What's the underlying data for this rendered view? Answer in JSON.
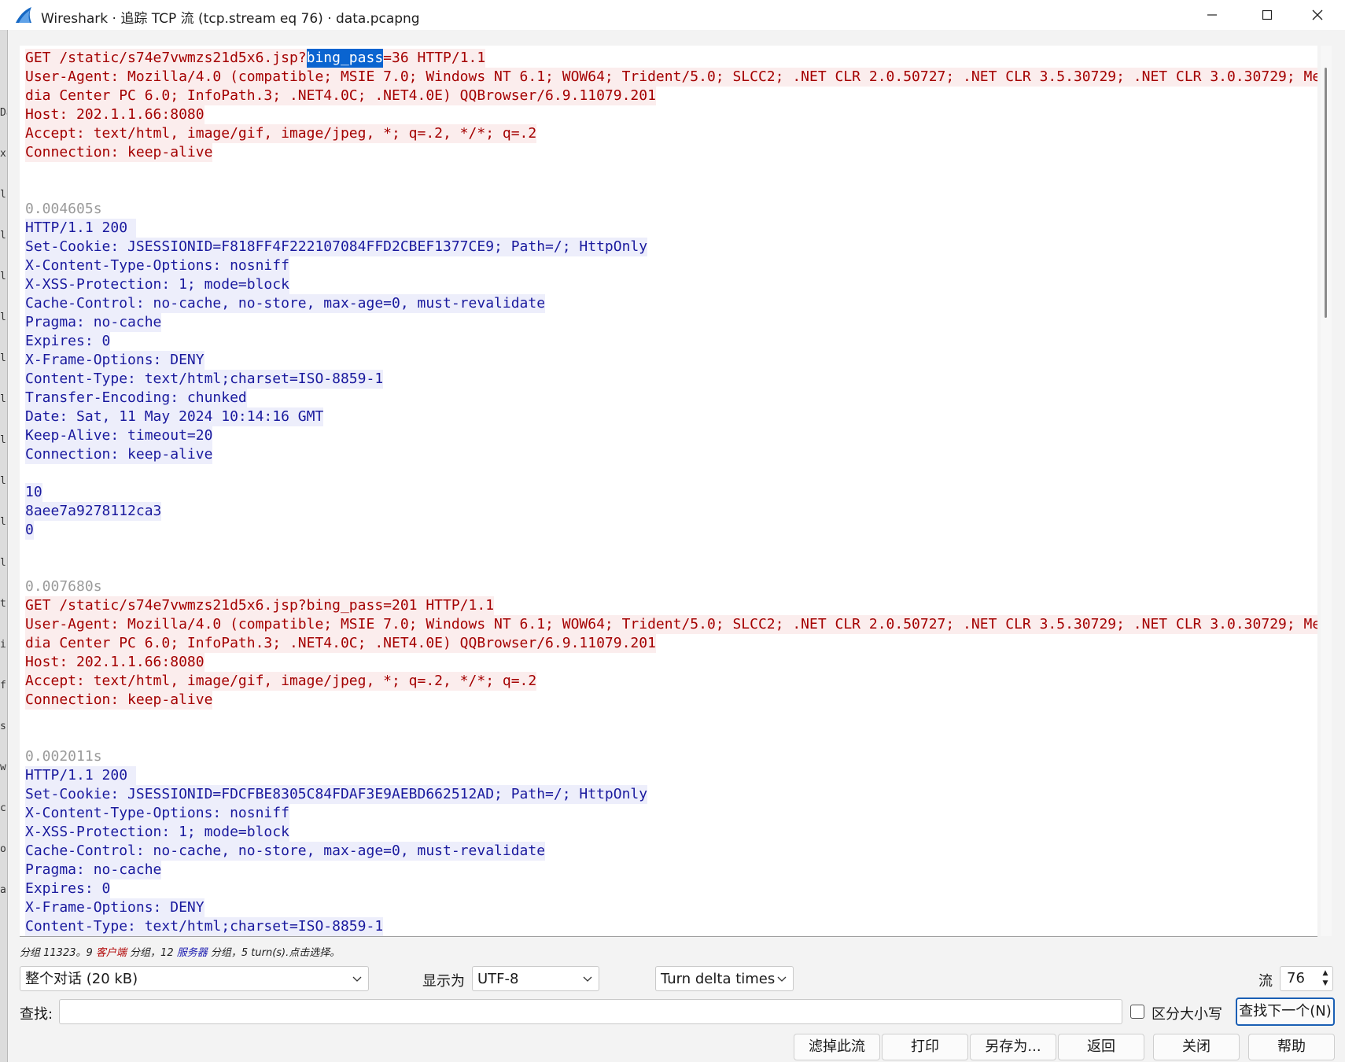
{
  "window": {
    "title": "Wireshark · 追踪 TCP 流 (tcp.stream eq 76) · data.pcapng"
  },
  "stream": {
    "blocks": [
      {
        "kind": "client",
        "time": "",
        "lines": [
          [
            "GET /static/s74e7vwmzs21d5x6.jsp?",
            "bing_pass",
            "=36 HTTP/1.1"
          ],
          "User-Agent: Mozilla/4.0 (compatible; MSIE 7.0; Windows NT 6.1; WOW64; Trident/5.0; SLCC2; .NET CLR 2.0.50727; .NET CLR 3.5.30729; .NET CLR 3.0.30729; Me",
          "dia Center PC 6.0; InfoPath.3; .NET4.0C; .NET4.0E) QQBrowser/6.9.11079.201",
          "Host: 202.1.1.66:8080",
          "Accept: text/html, image/gif, image/jpeg, *; q=.2, */*; q=.2",
          "Connection: keep-alive",
          ""
        ]
      },
      {
        "kind": "server",
        "time": "0.004605s",
        "lines": [
          "HTTP/1.1 200 ",
          "Set-Cookie: JSESSIONID=F818FF4F222107084FFD2CBEF1377CE9; Path=/; HttpOnly",
          "X-Content-Type-Options: nosniff",
          "X-XSS-Protection: 1; mode=block",
          "Cache-Control: no-cache, no-store, max-age=0, must-revalidate",
          "Pragma: no-cache",
          "Expires: 0",
          "X-Frame-Options: DENY",
          "Content-Type: text/html;charset=ISO-8859-1",
          "Transfer-Encoding: chunked",
          "Date: Sat, 11 May 2024 10:14:16 GMT",
          "Keep-Alive: timeout=20",
          "Connection: keep-alive",
          "",
          "10",
          "8aee7a9278112ca3",
          "0",
          ""
        ]
      },
      {
        "kind": "client",
        "time": "0.007680s",
        "lines": [
          "GET /static/s74e7vwmzs21d5x6.jsp?bing_pass=201 HTTP/1.1",
          "User-Agent: Mozilla/4.0 (compatible; MSIE 7.0; Windows NT 6.1; WOW64; Trident/5.0; SLCC2; .NET CLR 2.0.50727; .NET CLR 3.5.30729; .NET CLR 3.0.30729; Me",
          "dia Center PC 6.0; InfoPath.3; .NET4.0C; .NET4.0E) QQBrowser/6.9.11079.201",
          "Host: 202.1.1.66:8080",
          "Accept: text/html, image/gif, image/jpeg, *; q=.2, */*; q=.2",
          "Connection: keep-alive",
          ""
        ]
      },
      {
        "kind": "server",
        "time": "0.002011s",
        "lines": [
          "HTTP/1.1 200 ",
          "Set-Cookie: JSESSIONID=FDCFBE8305C84FDAF3E9AEBD662512AD; Path=/; HttpOnly",
          "X-Content-Type-Options: nosniff",
          "X-XSS-Protection: 1; mode=block",
          "Cache-Control: no-cache, no-store, max-age=0, must-revalidate",
          "Pragma: no-cache",
          "Expires: 0",
          "X-Frame-Options: DENY",
          "Content-Type: text/html;charset=ISO-8859-1"
        ]
      }
    ]
  },
  "status": {
    "prefix": "分组 11323。9 ",
    "client_label": "客户端",
    "middle": " 分组，12 ",
    "server_label": "服务器",
    "suffix": " 分组，5 turn(s).点击选择。"
  },
  "controls": {
    "conversation": "整个对话  (20 kB)",
    "show_as_label": "显示为",
    "encoding": "UTF-8",
    "delta_mode": "Turn delta times",
    "stream_label": "流",
    "stream_number": "76"
  },
  "find": {
    "label": "查找:",
    "value": "",
    "case_label": "区分大小写",
    "next_label": "查找下一个(N)"
  },
  "buttons": {
    "filter_out": "滤掉此流",
    "print": "打印",
    "save_as": "另存为...",
    "back": "返回",
    "close": "关闭",
    "help": "帮助"
  },
  "left_strip_chars": [
    "Da",
    "x",
    "l",
    "l",
    "l",
    "l",
    "l",
    "l",
    "l",
    "l",
    "l",
    "l",
    "t",
    "i",
    "f",
    "s",
    "w",
    "c",
    "o",
    "ar"
  ]
}
